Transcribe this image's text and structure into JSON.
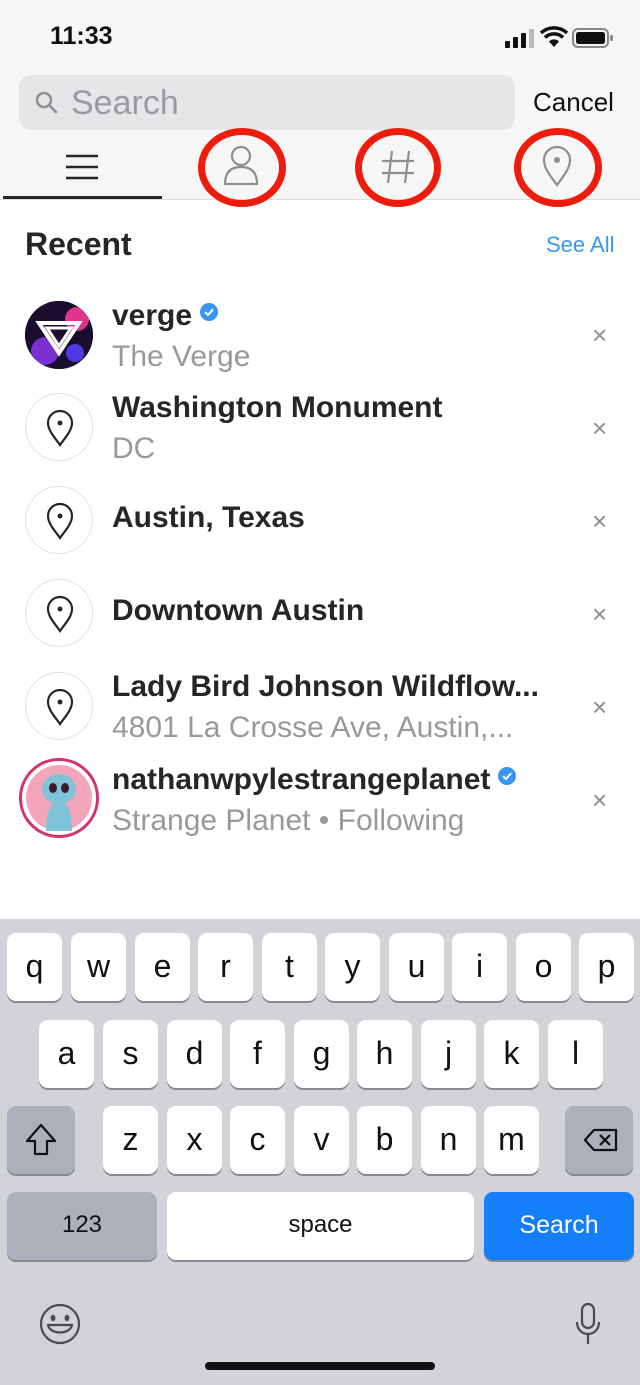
{
  "status_bar": {
    "time": "11:33"
  },
  "search": {
    "placeholder": "Search",
    "cancel_label": "Cancel"
  },
  "tabs": [
    {
      "name": "top",
      "icon": "hamburger-icon",
      "active": true
    },
    {
      "name": "accounts",
      "icon": "person-icon",
      "highlighted": true
    },
    {
      "name": "tags",
      "icon": "hashtag-icon",
      "highlighted": true
    },
    {
      "name": "places",
      "icon": "location-pin-icon",
      "highlighted": true
    }
  ],
  "highlight_color": "#ee1c0c",
  "accent_color": "#3897f0",
  "recent": {
    "title": "Recent",
    "see_all": "See All",
    "items": [
      {
        "title": "verge",
        "subtitle": "The Verge",
        "verified": true,
        "avatar": "verge-logo"
      },
      {
        "title": "Washington Monument",
        "subtitle": "DC",
        "avatar": "location-pin-icon"
      },
      {
        "title": "Austin, Texas",
        "subtitle": "",
        "avatar": "location-pin-icon"
      },
      {
        "title": "Downtown Austin",
        "subtitle": "",
        "avatar": "location-pin-icon"
      },
      {
        "title": "Lady Bird Johnson Wildflow...",
        "subtitle": "4801 La Crosse Ave, Austin,...",
        "avatar": "location-pin-icon"
      },
      {
        "title": "nathanwpylestrangeplanet",
        "subtitle": "Strange Planet • Following",
        "verified": true,
        "avatar": "strange-planet-avatar"
      }
    ],
    "remove_glyph": "×"
  },
  "keyboard": {
    "row1": [
      "q",
      "w",
      "e",
      "r",
      "t",
      "y",
      "u",
      "i",
      "o",
      "p"
    ],
    "row2": [
      "a",
      "s",
      "d",
      "f",
      "g",
      "h",
      "j",
      "k",
      "l"
    ],
    "row3": [
      "z",
      "x",
      "c",
      "v",
      "b",
      "n",
      "m"
    ],
    "numbers_label": "123",
    "space_label": "space",
    "return_label": "Search"
  }
}
